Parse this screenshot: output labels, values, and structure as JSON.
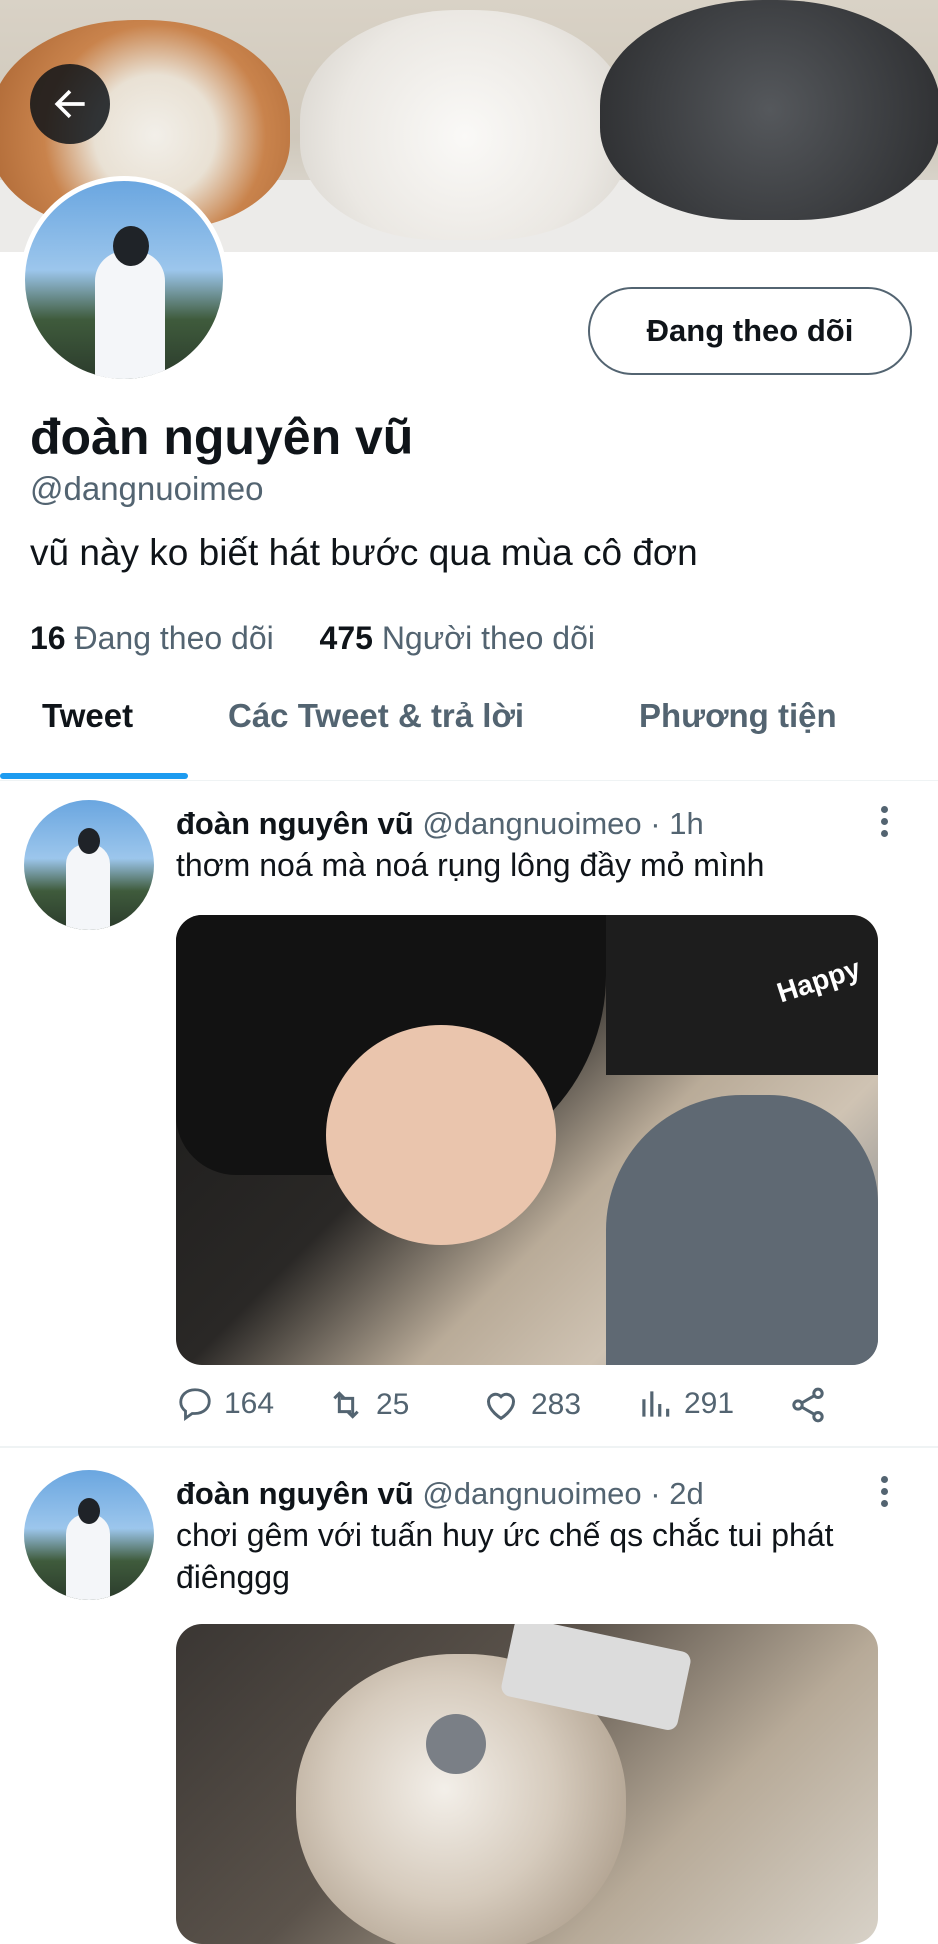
{
  "profile": {
    "name": "đoàn nguyên vũ",
    "handle": "@dangnuoimeo",
    "bio": "vũ này ko biết hát bước qua mùa cô đơn",
    "following_count": "16",
    "following_label": "Đang theo dõi",
    "followers_count": "475",
    "followers_label": "Người theo dõi",
    "follow_button": "Đang theo dõi"
  },
  "tabs": [
    {
      "label": "Tweet",
      "active": true
    },
    {
      "label": "Các Tweet & trả lời",
      "active": false
    },
    {
      "label": "Phương tiện",
      "active": false
    }
  ],
  "tweets": [
    {
      "name": "đoàn nguyên vũ",
      "handle": "@dangnuoimeo",
      "time": "· 1h",
      "text": "thơm noá mà noá rụng lông đầy mỏ mình",
      "media_caption": "Happy",
      "replies": "164",
      "retweets": "25",
      "likes": "283",
      "views": "291"
    },
    {
      "name": "đoàn nguyên vũ",
      "handle": "@dangnuoimeo",
      "time": "· 2d",
      "text": "chơi gêm với tuấn huy ức chế qs chắc tui phát điênggg"
    }
  ],
  "icons": {
    "back": "arrow-left-icon",
    "more": "more-vertical-icon",
    "reply": "reply-icon",
    "retweet": "retweet-icon",
    "like": "heart-icon",
    "views": "views-icon",
    "share": "share-icon"
  },
  "colors": {
    "accent": "#1d9bf0",
    "text": "#0f1419",
    "secondary": "#536471"
  }
}
